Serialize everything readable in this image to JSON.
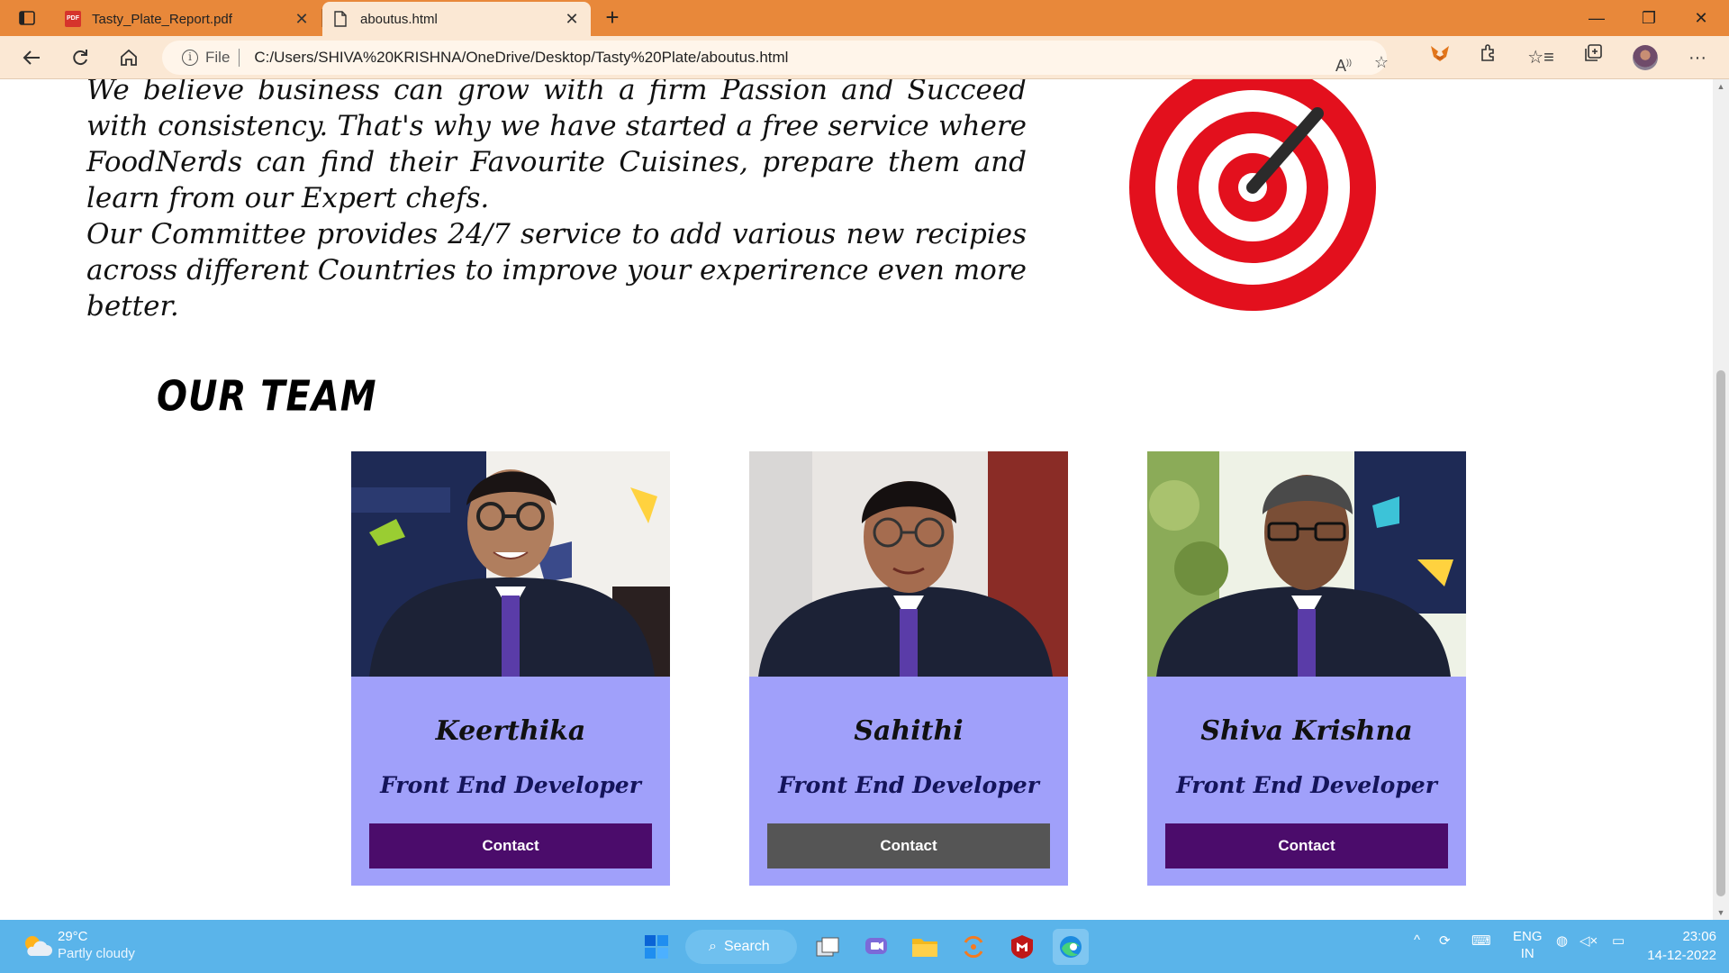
{
  "browser": {
    "tabs": [
      {
        "title": "Tasty_Plate_Report.pdf",
        "active": false,
        "icon": "pdf-icon"
      },
      {
        "title": "aboutus.html",
        "active": true,
        "icon": "file-icon"
      }
    ],
    "address": {
      "file_label": "File",
      "url": "C:/Users/SHIVA%20KRISHNA/OneDrive/Desktop/Tasty%20Plate/aboutus.html"
    },
    "accent_color": "#e8883a"
  },
  "page": {
    "about_paragraph": "We believe business can grow with a firm Passion and Succeed with consistency. That's why we have started a free service where FoodNerds can find their Favourite Cuisines, prepare them and learn from our Expert chefs.",
    "committee_paragraph": "Our Committee provides 24/7 service to add various new recipies across different Countries to improve your experirence even more better.",
    "team_heading": "OUR TEAM",
    "team": [
      {
        "name": "Keerthika",
        "role": "Front End Developer",
        "contact_label": "Contact",
        "button_color": "#4b0c6b"
      },
      {
        "name": "Sahithi",
        "role": "Front End Developer",
        "contact_label": "Contact",
        "button_color": "#555555"
      },
      {
        "name": "Shiva Krishna",
        "role": "Front End Developer",
        "contact_label": "Contact",
        "button_color": "#4b0c6b"
      }
    ],
    "card_color": "#a0a0fa"
  },
  "taskbar": {
    "weather": {
      "temp": "29°C",
      "condition": "Partly cloudy"
    },
    "search_label": "Search",
    "language": {
      "line1": "ENG",
      "line2": "IN"
    },
    "time": "23:06",
    "date": "14-12-2022"
  }
}
